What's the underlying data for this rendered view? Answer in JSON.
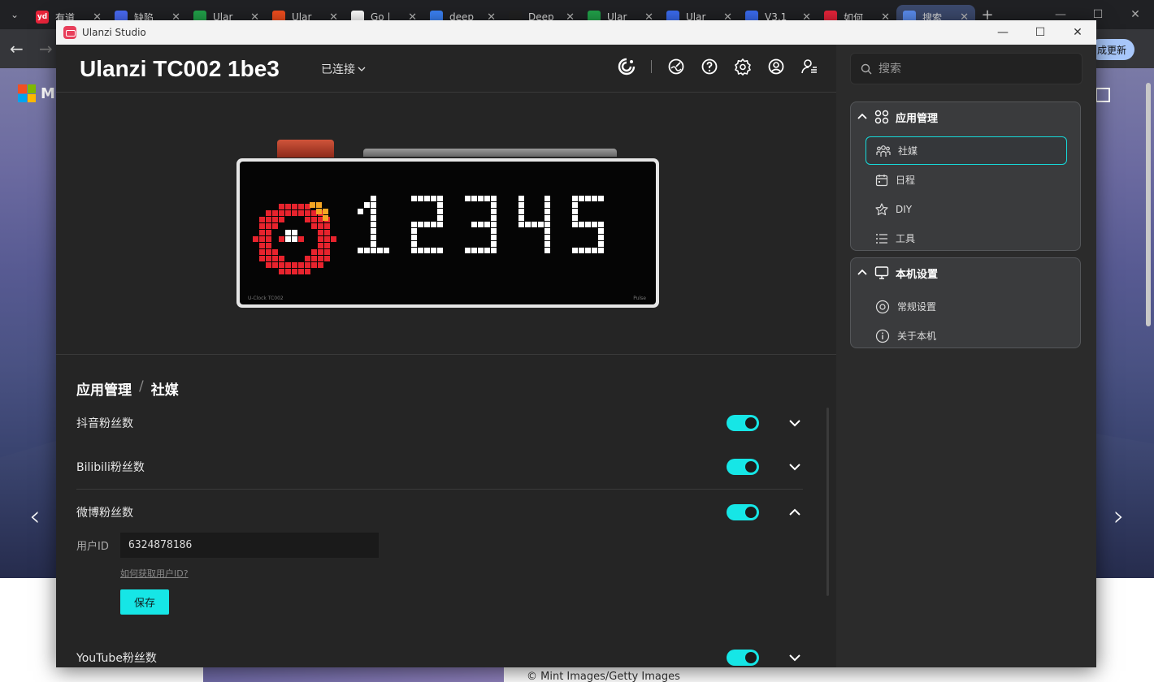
{
  "browser": {
    "tabs": [
      {
        "label": "有道",
        "favicon": "yd",
        "color": "#e8243a"
      },
      {
        "label": "缺陷",
        "favicon": "",
        "color": "#4a6cf7"
      },
      {
        "label": "Ular",
        "favicon": "",
        "color": "#22a34a"
      },
      {
        "label": "Ular",
        "favicon": "",
        "color": "#f24e1e"
      },
      {
        "label": "Go |",
        "favicon": "",
        "color": "#ffffff"
      },
      {
        "label": "deep",
        "favicon": "",
        "color": "#3b82f6"
      },
      {
        "label": "Deep",
        "favicon": "",
        "color": "#222222"
      },
      {
        "label": "Ular",
        "favicon": "",
        "color": "#22a34a"
      },
      {
        "label": "Ular",
        "favicon": "",
        "color": "#3b6cf0"
      },
      {
        "label": "V3.1",
        "favicon": "",
        "color": "#3b6cf0"
      },
      {
        "label": "如何",
        "favicon": "",
        "color": "#e8243a"
      },
      {
        "label": "搜索",
        "favicon": "",
        "color": "#5b8def"
      }
    ],
    "update_label": "成更新",
    "logo_text": "M",
    "credit": "© Mint Images/Getty Images"
  },
  "app": {
    "window_title": "Ulanzi Studio",
    "device_name": "Ulanzi TC002 1be3",
    "connection_status": "已连接",
    "display": {
      "digits": "12345",
      "model_label": "U-Clock TC002",
      "brand_label": "Pulse"
    },
    "breadcrumb": {
      "parent": "应用管理",
      "separator": "/",
      "current": "社媒"
    },
    "rows": [
      {
        "label": "抖音粉丝数",
        "enabled": true,
        "expanded": false
      },
      {
        "label": "Bilibili粉丝数",
        "enabled": true,
        "expanded": false
      },
      {
        "label": "微博粉丝数",
        "enabled": true,
        "expanded": true
      },
      {
        "label": "YouTube粉丝数",
        "enabled": true,
        "expanded": false
      }
    ],
    "weibo_form": {
      "user_id_label": "用户ID",
      "user_id_value": "6324878186",
      "help_link": "如何获取用户ID?",
      "save_label": "保存"
    }
  },
  "sidebar": {
    "search_placeholder": "搜索",
    "groups": [
      {
        "title": "应用管理",
        "items": [
          {
            "label": "社媒",
            "icon": "people-icon",
            "active": true
          },
          {
            "label": "日程",
            "icon": "calendar-icon",
            "active": false
          },
          {
            "label": "DIY",
            "icon": "diy-icon",
            "active": false
          },
          {
            "label": "工具",
            "icon": "list-icon",
            "active": false
          }
        ]
      },
      {
        "title": "本机设置",
        "items": [
          {
            "label": "常规设置",
            "icon": "settings-circle-icon",
            "active": false
          },
          {
            "label": "关于本机",
            "icon": "info-icon",
            "active": false
          }
        ]
      }
    ]
  },
  "colors": {
    "accent": "#16e6e6",
    "weibo_red": "#e8232d",
    "weibo_yellow": "#f5a623"
  }
}
